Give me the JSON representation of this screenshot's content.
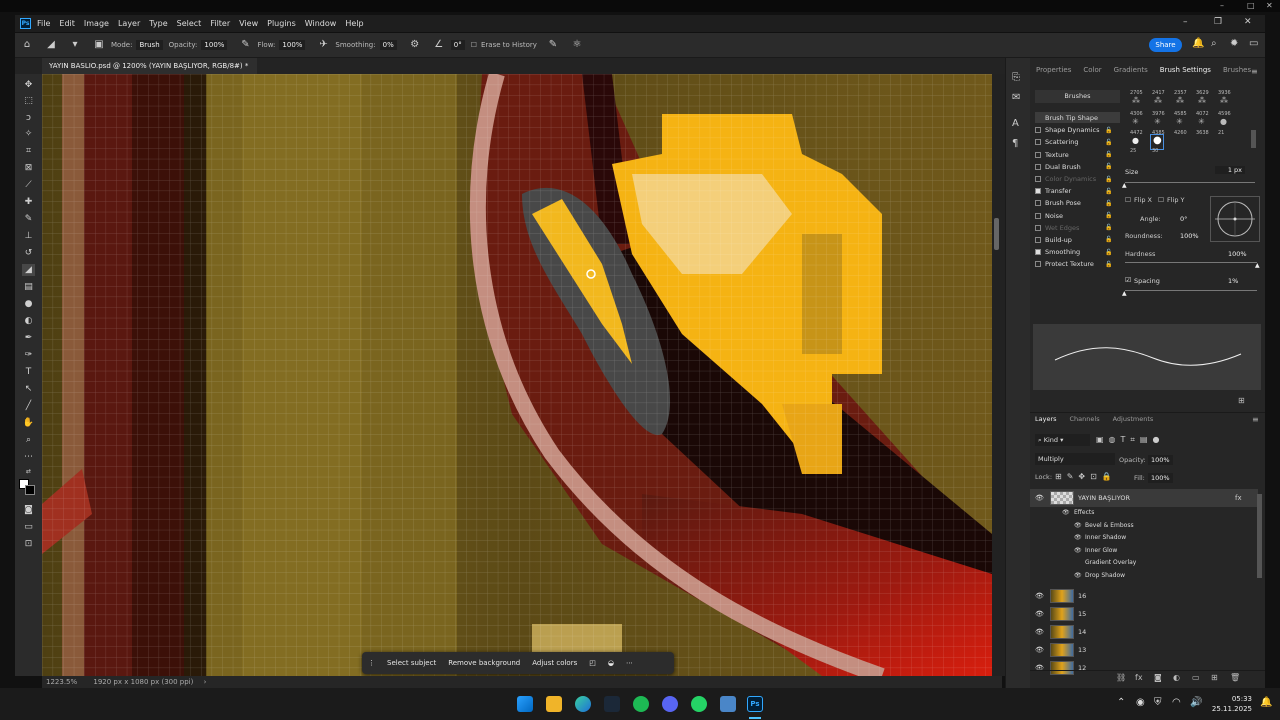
{
  "menu": {
    "app_logo": "Ps",
    "items": [
      "File",
      "Edit",
      "Image",
      "Layer",
      "Type",
      "Select",
      "Filter",
      "View",
      "Plugins",
      "Window",
      "Help"
    ]
  },
  "options": {
    "mode_label": "Mode:",
    "mode_value": "Brush",
    "opacity_label": "Opacity:",
    "opacity_value": "100%",
    "flow_label": "Flow:",
    "flow_value": "100%",
    "smoothing_label": "Smoothing:",
    "smoothing_value": "0%",
    "angle_value": "0°",
    "erase_history_label": "Erase to History",
    "share_label": "Share"
  },
  "document": {
    "tab_title": "YAYIN BASLIO.psd @ 1200% (YAYIN BAŞLIYOR, RGB/8#) *",
    "zoom_readout": "1223.5%",
    "doc_info": "1920 px x 1080 px (300 ppi)"
  },
  "contextual_bar": {
    "select_subject": "Select subject",
    "remove_background": "Remove background",
    "adjust_colors": "Adjust colors"
  },
  "right_tabs": [
    "Properties",
    "Color",
    "Gradients",
    "Brush Settings",
    "Brushes"
  ],
  "brush_settings": {
    "brushes_button": "Brushes",
    "options": [
      {
        "label": "Brush Tip Shape",
        "checked": null,
        "dim": false
      },
      {
        "label": "Shape Dynamics",
        "checked": false,
        "dim": false
      },
      {
        "label": "Scattering",
        "checked": false,
        "dim": false
      },
      {
        "label": "Texture",
        "checked": false,
        "dim": false
      },
      {
        "label": "Dual Brush",
        "checked": false,
        "dim": false
      },
      {
        "label": "Color Dynamics",
        "checked": false,
        "dim": true
      },
      {
        "label": "Transfer",
        "checked": true,
        "dim": false
      },
      {
        "label": "Brush Pose",
        "checked": false,
        "dim": false
      },
      {
        "label": "Noise",
        "checked": false,
        "dim": false
      },
      {
        "label": "Wet Edges",
        "checked": false,
        "dim": true
      },
      {
        "label": "Build-up",
        "checked": false,
        "dim": false
      },
      {
        "label": "Smoothing",
        "checked": true,
        "dim": false
      },
      {
        "label": "Protect Texture",
        "checked": false,
        "dim": false
      }
    ],
    "preset_numbers_row1": [
      "2705",
      "2417",
      "2357",
      "3629",
      "3936"
    ],
    "preset_numbers_row2": [
      "4306",
      "3976",
      "4585",
      "4072",
      "4596"
    ],
    "preset_numbers_row3": [
      "4472",
      "4385",
      "4260",
      "3638",
      "21"
    ],
    "preset_numbers_row4": [
      "25",
      "30"
    ],
    "size_label": "Size",
    "size_value": "1 px",
    "flip_x": "Flip X",
    "flip_y": "Flip Y",
    "angle_label": "Angle:",
    "angle_value": "0°",
    "roundness_label": "Roundness:",
    "roundness_value": "100%",
    "hardness_label": "Hardness",
    "hardness_value": "100%",
    "spacing_label": "Spacing",
    "spacing_value": "1%"
  },
  "layers_panel": {
    "tabs": [
      "Layers",
      "Channels",
      "Adjustments"
    ],
    "filter_kind": "Kind",
    "blend_mode": "Multiply",
    "opacity_label": "Opacity:",
    "opacity_value": "100%",
    "lock_label": "Lock:",
    "fill_label": "Fill:",
    "fill_value": "100%",
    "active_layer": "YAYIN BAŞLIYOR",
    "fx_label": "fx",
    "effects_label": "Effects",
    "effects": [
      "Bevel & Emboss",
      "Inner Shadow",
      "Inner Glow",
      "Gradient Overlay",
      "Drop Shadow"
    ],
    "effects_visible": [
      true,
      true,
      true,
      false,
      true
    ],
    "layers": [
      "16",
      "15",
      "14",
      "13",
      "12"
    ]
  },
  "taskbar": {
    "time": "05:33",
    "date": "25.11.2025"
  }
}
